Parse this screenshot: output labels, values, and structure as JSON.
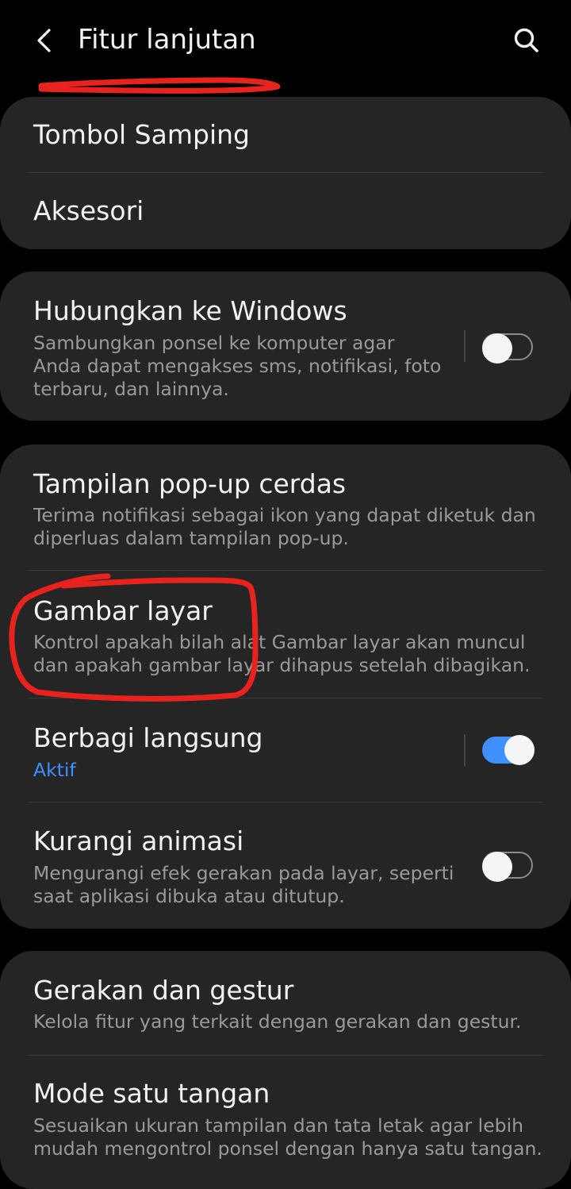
{
  "header": {
    "title": "Fitur lanjutan",
    "back_icon": "chevron-left-icon",
    "search_icon": "search-icon"
  },
  "colors": {
    "background": "#000000",
    "card": "#252525",
    "accent": "#3e91ff",
    "annotation": "#e8231d"
  },
  "groups": [
    {
      "items": [
        {
          "title": "Tombol Samping"
        },
        {
          "title": "Aksesori"
        }
      ]
    },
    {
      "items": [
        {
          "title": "Hubungkan ke Windows",
          "description": "Sambungkan ponsel ke komputer agar\nAnda dapat mengakses sms, notifikasi, foto\nterbaru, dan lainnya.",
          "toggle": false
        }
      ]
    },
    {
      "items": [
        {
          "title": "Tampilan pop-up cerdas",
          "description": "Terima notifikasi sebagai ikon yang dapat diketuk dan\ndiperluas dalam tampilan pop-up."
        },
        {
          "title": "Gambar layar",
          "description": "Kontrol apakah bilah alat Gambar layar akan muncul\ndan apakah gambar layar dihapus setelah dibagikan."
        },
        {
          "title": "Berbagi langsung",
          "status": "Aktif",
          "toggle": true
        },
        {
          "title": "Kurangi animasi",
          "description": "Mengurangi efek gerakan pada layar, seperti\nsaat aplikasi dibuka atau ditutup.",
          "toggle": false
        }
      ]
    },
    {
      "items": [
        {
          "title": "Gerakan dan gestur",
          "description": "Kelola fitur yang terkait dengan gerakan dan gestur."
        },
        {
          "title": "Mode satu tangan",
          "description": "Sesuaikan ukuran tampilan dan tata letak agar lebih\nmudah mengontrol ponsel dengan hanya satu tangan."
        }
      ]
    }
  ]
}
